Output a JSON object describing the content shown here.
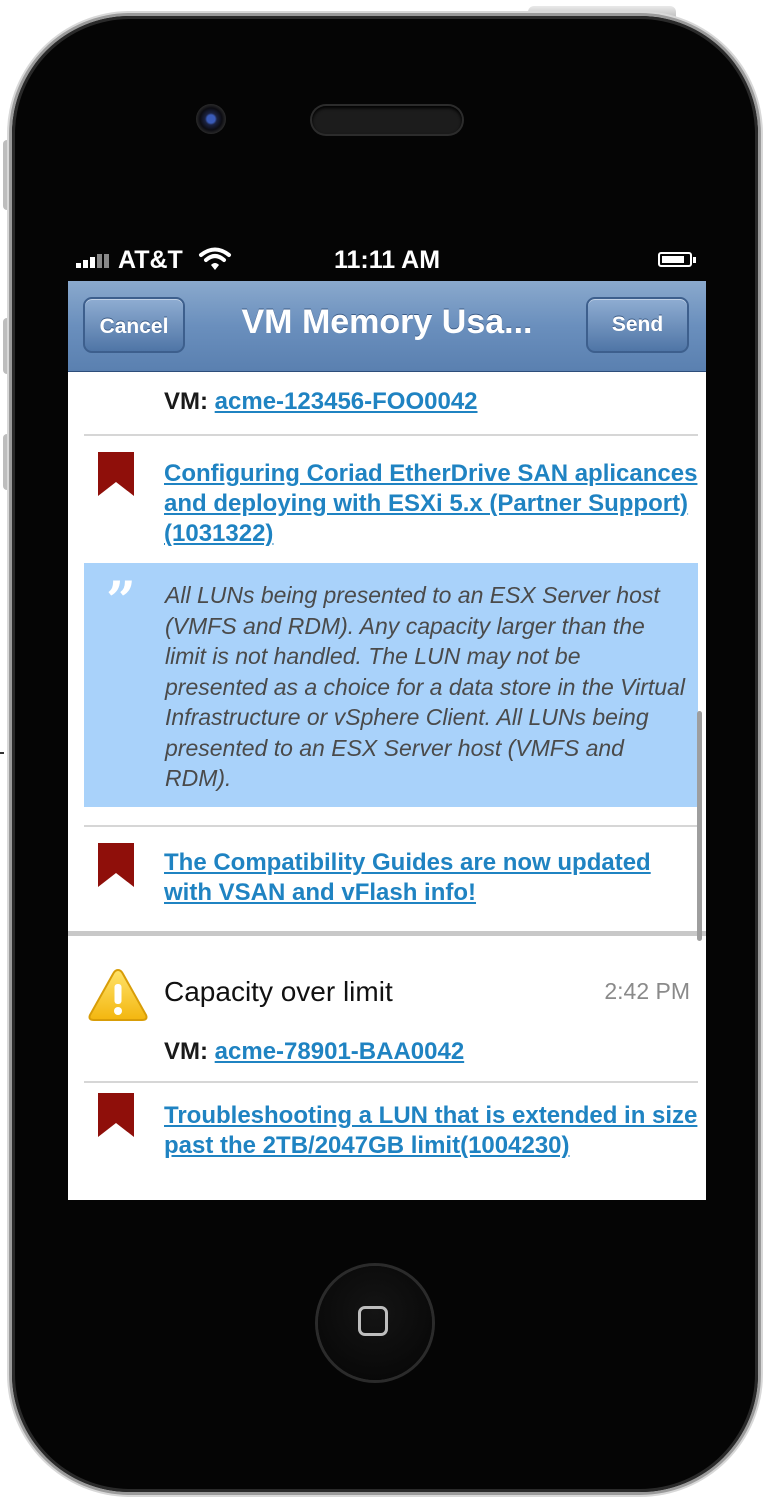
{
  "status_bar": {
    "carrier": "AT&T",
    "time": "11:11 AM"
  },
  "nav": {
    "cancel_label": "Cancel",
    "title": "VM Memory Usa...",
    "send_label": "Send"
  },
  "feed": {
    "vm_label": "VM:",
    "first_vm": "acme-123456-FOO0042",
    "kb_article_1": "Configuring Coriad EtherDrive SAN aplicances and deploying with ESXi 5.x (Partner Support) (1031322)",
    "quote": "All LUNs being presented to an ESX Server host (VMFS and RDM). Any capacity larger than the limit is not handled. The LUN may not be presented as a choice for a data store in the Virtual Infrastructure or vSphere Client. All LUNs being presented to an ESX Server host (VMFS and RDM).",
    "kb_article_2": "The Compatibility Guides are now updated with VSAN and vFlash info!",
    "alert": {
      "title": "Capacity over limit",
      "time": "2:42 PM",
      "vm": "acme-78901-BAA0042"
    },
    "kb_article_3": "Troubleshooting a LUN that is extended in size past the 2TB/2047GB limit(1004230)"
  },
  "colors": {
    "nav_blue": "#6a8fbd",
    "link_blue": "#1f83c2",
    "quote_bg": "#a9d2fa",
    "bookmark_red": "#8f0f0a",
    "warning_yellow": "#f6c51a"
  }
}
